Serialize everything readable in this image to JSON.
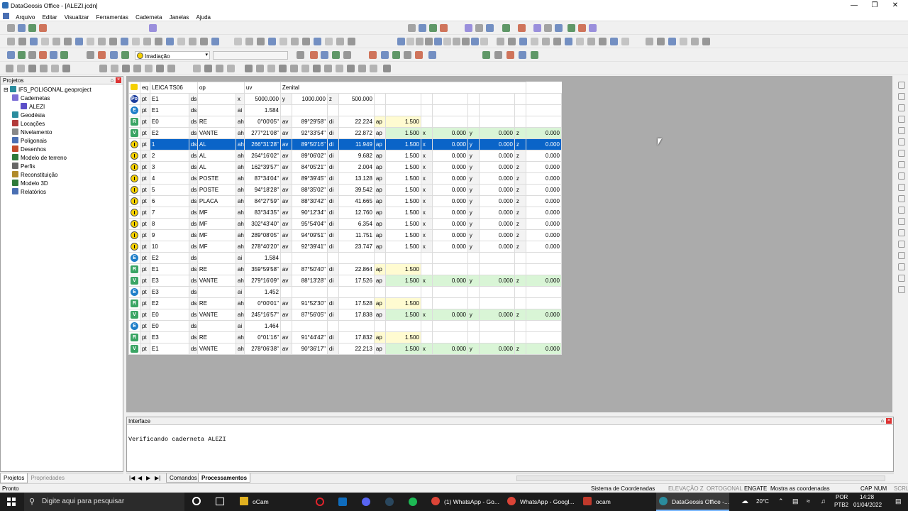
{
  "window": {
    "title": "DataGeosis Office - [ALEZI.jcdn]"
  },
  "menu": [
    "Arquivo",
    "Editar",
    "Visualizar",
    "Ferramentas",
    "Caderneta",
    "Janelas",
    "Ajuda"
  ],
  "toolbar": {
    "mode_label": "Irradiação"
  },
  "projects": {
    "header": "Projetos",
    "tree": [
      {
        "label": "IFS_POLIGONAL.geoproject",
        "icon": "globe-icon",
        "color": "#2a8c9e",
        "level": 0
      },
      {
        "label": "Cadernetas",
        "icon": "notebook-icon",
        "color": "#7d6fd6",
        "level": 1
      },
      {
        "label": "ALEZI",
        "icon": "table-icon",
        "color": "#5c4fc8",
        "level": 2
      },
      {
        "label": "Geodésia",
        "icon": "globe-icon",
        "color": "#2a8c9e",
        "level": 1
      },
      {
        "label": "Locações",
        "icon": "marker-icon",
        "color": "#b23a3a",
        "level": 1
      },
      {
        "label": "Nivelamento",
        "icon": "level-icon",
        "color": "#888888",
        "level": 1
      },
      {
        "label": "Poligonais",
        "icon": "polygon-icon",
        "color": "#4a6fb3",
        "level": 1
      },
      {
        "label": "Desenhos",
        "icon": "drawing-icon",
        "color": "#c44b2a",
        "level": 1
      },
      {
        "label": "Modelo de terreno",
        "icon": "terrain-icon",
        "color": "#2f7a3a",
        "level": 1
      },
      {
        "label": "Perfis",
        "icon": "profile-icon",
        "color": "#666666",
        "level": 1
      },
      {
        "label": "Reconstituição",
        "icon": "reconstruction-icon",
        "color": "#b08a2a",
        "level": 1
      },
      {
        "label": "Modelo 3D",
        "icon": "model-3d-icon",
        "color": "#2f7a3a",
        "level": 1
      },
      {
        "label": "Relatórios",
        "icon": "report-icon",
        "color": "#4a6fb3",
        "level": 1
      }
    ],
    "tabs": [
      "Projetos",
      "Propriedades"
    ]
  },
  "grid": {
    "header": {
      "eq": "eq",
      "instrument": "LEICA TS06",
      "op": "op",
      "uv": "uv",
      "angle": "Zenital"
    },
    "rows": [
      {
        "type": "Po",
        "c": [
          "pt",
          "E1",
          "ds",
          "",
          "x",
          "5000.000",
          "y",
          "1000.000",
          "z",
          "500.000",
          "",
          "",
          "",
          "",
          "",
          "",
          "",
          ""
        ]
      },
      {
        "type": "E",
        "c": [
          "pt",
          "E1",
          "ds",
          "",
          "ai",
          "1.584",
          "",
          "",
          "",
          "",
          "",
          "",
          "",
          "",
          "",
          "",
          "",
          ""
        ]
      },
      {
        "type": "R",
        "c": [
          "pt",
          "E0",
          "ds",
          "RE",
          "ah",
          "0°00'05\"",
          "av",
          "89°29'58\"",
          "di",
          "22.224",
          "ap",
          "1.500",
          "",
          "",
          "",
          "",
          "",
          ""
        ]
      },
      {
        "type": "V",
        "c": [
          "pt",
          "E2",
          "ds",
          "VANTE",
          "ah",
          "277°21'08\"",
          "av",
          "92°33'54\"",
          "di",
          "22.872",
          "ap",
          "1.500",
          "x",
          "0.000",
          "y",
          "0.000",
          "z",
          "0.000"
        ]
      },
      {
        "type": "I",
        "sel": true,
        "c": [
          "pt",
          "1",
          "ds",
          "AL",
          "ah",
          "266°31'28\"",
          "av",
          "89°50'16\"",
          "di",
          "11.949",
          "ap",
          "1.500",
          "x",
          "0.000",
          "y",
          "0.000",
          "z",
          "0.000"
        ]
      },
      {
        "type": "I",
        "c": [
          "pt",
          "2",
          "ds",
          "AL",
          "ah",
          "264°16'02\"",
          "av",
          "89°06'02\"",
          "di",
          "9.682",
          "ap",
          "1.500",
          "x",
          "0.000",
          "y",
          "0.000",
          "z",
          "0.000"
        ]
      },
      {
        "type": "I",
        "c": [
          "pt",
          "3",
          "ds",
          "AL",
          "ah",
          "162°39'57\"",
          "av",
          "84°05'21\"",
          "di",
          "2.004",
          "ap",
          "1.500",
          "x",
          "0.000",
          "y",
          "0.000",
          "z",
          "0.000"
        ]
      },
      {
        "type": "I",
        "c": [
          "pt",
          "4",
          "ds",
          "POSTE",
          "ah",
          "87°34'04\"",
          "av",
          "89°39'45\"",
          "di",
          "13.128",
          "ap",
          "1.500",
          "x",
          "0.000",
          "y",
          "0.000",
          "z",
          "0.000"
        ]
      },
      {
        "type": "I",
        "c": [
          "pt",
          "5",
          "ds",
          "POSTE",
          "ah",
          "94°18'28\"",
          "av",
          "88°35'02\"",
          "di",
          "39.542",
          "ap",
          "1.500",
          "x",
          "0.000",
          "y",
          "0.000",
          "z",
          "0.000"
        ]
      },
      {
        "type": "I",
        "c": [
          "pt",
          "6",
          "ds",
          "PLACA",
          "ah",
          "84°27'59\"",
          "av",
          "88°30'42\"",
          "di",
          "41.665",
          "ap",
          "1.500",
          "x",
          "0.000",
          "y",
          "0.000",
          "z",
          "0.000"
        ]
      },
      {
        "type": "I",
        "c": [
          "pt",
          "7",
          "ds",
          "MF",
          "ah",
          "83°34'35\"",
          "av",
          "90°12'34\"",
          "di",
          "12.760",
          "ap",
          "1.500",
          "x",
          "0.000",
          "y",
          "0.000",
          "z",
          "0.000"
        ]
      },
      {
        "type": "I",
        "c": [
          "pt",
          "8",
          "ds",
          "MF",
          "ah",
          "302°43'40\"",
          "av",
          "95°54'04\"",
          "di",
          "6.354",
          "ap",
          "1.500",
          "x",
          "0.000",
          "y",
          "0.000",
          "z",
          "0.000"
        ]
      },
      {
        "type": "I",
        "c": [
          "pt",
          "9",
          "ds",
          "MF",
          "ah",
          "289°08'05\"",
          "av",
          "94°09'51\"",
          "di",
          "11.751",
          "ap",
          "1.500",
          "x",
          "0.000",
          "y",
          "0.000",
          "z",
          "0.000"
        ]
      },
      {
        "type": "I",
        "c": [
          "pt",
          "10",
          "ds",
          "MF",
          "ah",
          "278°40'20\"",
          "av",
          "92°39'41\"",
          "di",
          "23.747",
          "ap",
          "1.500",
          "x",
          "0.000",
          "y",
          "0.000",
          "z",
          "0.000"
        ]
      },
      {
        "type": "E",
        "c": [
          "pt",
          "E2",
          "ds",
          "",
          "ai",
          "1.584",
          "",
          "",
          "",
          "",
          "",
          "",
          "",
          "",
          "",
          "",
          "",
          ""
        ]
      },
      {
        "type": "R",
        "c": [
          "pt",
          "E1",
          "ds",
          "RE",
          "ah",
          "359°59'58\"",
          "av",
          "87°50'40\"",
          "di",
          "22.864",
          "ap",
          "1.500",
          "",
          "",
          "",
          "",
          "",
          ""
        ]
      },
      {
        "type": "V",
        "c": [
          "pt",
          "E3",
          "ds",
          "VANTE",
          "ah",
          "279°16'09\"",
          "av",
          "88°13'28\"",
          "di",
          "17.526",
          "ap",
          "1.500",
          "x",
          "0.000",
          "y",
          "0.000",
          "z",
          "0.000"
        ]
      },
      {
        "type": "E",
        "c": [
          "pt",
          "E3",
          "ds",
          "",
          "ai",
          "1.452",
          "",
          "",
          "",
          "",
          "",
          "",
          "",
          "",
          "",
          "",
          "",
          ""
        ]
      },
      {
        "type": "R",
        "c": [
          "pt",
          "E2",
          "ds",
          "RE",
          "ah",
          "0°00'01\"",
          "av",
          "91°52'30\"",
          "di",
          "17.528",
          "ap",
          "1.500",
          "",
          "",
          "",
          "",
          "",
          ""
        ]
      },
      {
        "type": "V",
        "c": [
          "pt",
          "E0",
          "ds",
          "VANTE",
          "ah",
          "245°16'57\"",
          "av",
          "87°56'05\"",
          "di",
          "17.838",
          "ap",
          "1.500",
          "x",
          "0.000",
          "y",
          "0.000",
          "z",
          "0.000"
        ]
      },
      {
        "type": "E",
        "c": [
          "pt",
          "E0",
          "ds",
          "",
          "ai",
          "1.464",
          "",
          "",
          "",
          "",
          "",
          "",
          "",
          "",
          "",
          "",
          "",
          ""
        ]
      },
      {
        "type": "R",
        "c": [
          "pt",
          "E3",
          "ds",
          "RE",
          "ah",
          "0°01'16\"",
          "av",
          "91°44'42\"",
          "di",
          "17.832",
          "ap",
          "1.500",
          "",
          "",
          "",
          "",
          "",
          ""
        ]
      },
      {
        "type": "V",
        "c": [
          "pt",
          "E1",
          "ds",
          "VANTE",
          "ah",
          "278°06'38\"",
          "av",
          "90°36'17\"",
          "di",
          "22.213",
          "ap",
          "1.500",
          "x",
          "0.000",
          "y",
          "0.000",
          "z",
          "0.000"
        ]
      }
    ]
  },
  "badge_colors": {
    "Po": "#1f3f9e",
    "E": "#1f7fc9",
    "R": "#3aa564",
    "V": "#3aa564",
    "I": "#f5d000"
  },
  "interface": {
    "header": "Interface",
    "log": "Verificando caderneta ALEZI"
  },
  "bottom_tabs": [
    "Comandos",
    "Processamentos"
  ],
  "status": {
    "left": "Pronto",
    "items": [
      "Sistema de Coordenadas",
      "ELEVAÇÃO Z",
      "ORTOGONAL",
      "ENGATE",
      "Mostra as coordenadas",
      "CAP",
      "NUM",
      "SCRL"
    ]
  },
  "taskbar": {
    "search_placeholder": "Digite aqui para pesquisar",
    "apps": [
      {
        "label": "oCam",
        "color": "#e0b020"
      },
      {
        "label": "(1) WhatsApp - Go...",
        "color": "#db4437"
      },
      {
        "label": "WhatsApp - Googl...",
        "color": "#db4437"
      },
      {
        "label": "ocam",
        "color": "#c0392b"
      },
      {
        "label": "DataGeosis Office -...",
        "color": "#2a8c9e"
      }
    ],
    "weather": "20°C",
    "lang": "POR",
    "lang2": "PTB2",
    "time": "14:28",
    "date": "01/04/2022"
  }
}
